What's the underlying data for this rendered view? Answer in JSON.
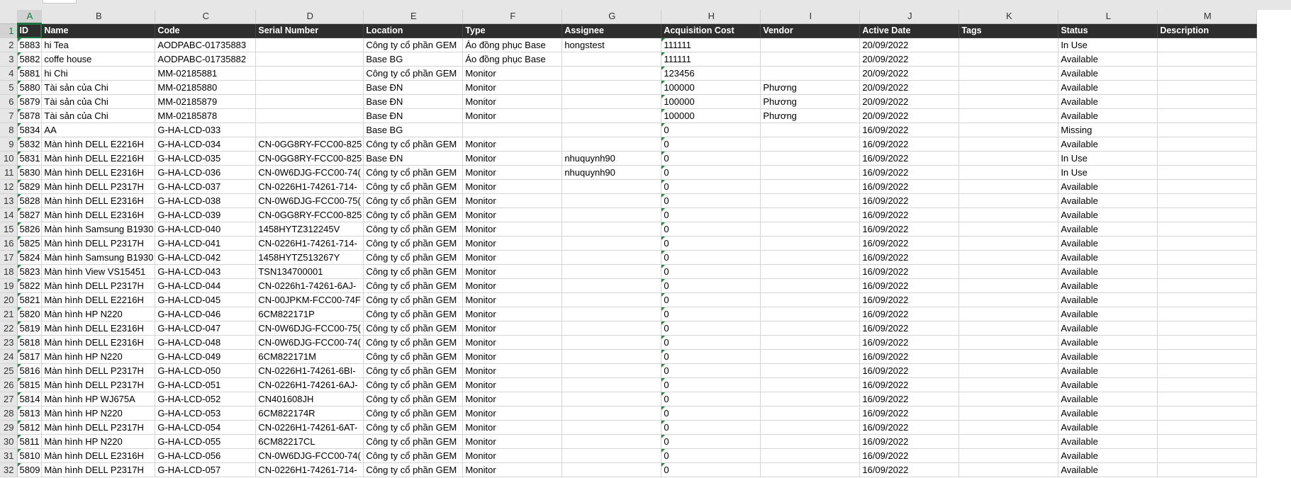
{
  "sheet": {
    "columns": [
      "A",
      "B",
      "C",
      "D",
      "E",
      "F",
      "G",
      "H",
      "I",
      "J",
      "K",
      "L",
      "M"
    ],
    "row_numbers": [
      "1",
      "2",
      "3",
      "4",
      "5",
      "6",
      "7",
      "8",
      "9",
      "10",
      "11",
      "12",
      "13",
      "14",
      "15",
      "16",
      "17",
      "18",
      "19",
      "20",
      "21",
      "22",
      "23",
      "24",
      "25",
      "26",
      "27",
      "28",
      "29",
      "30",
      "31",
      "32"
    ],
    "header": [
      "ID",
      "Name",
      "Code",
      "Serial Number",
      "Location",
      "Type",
      "Assignee",
      "Acquisition Cost",
      "Vendor",
      "Active Date",
      "Tags",
      "Status",
      "Description"
    ],
    "rows": [
      [
        "5883",
        "hi Tea",
        "AODPABC-01735883",
        "",
        "Công ty cổ phần GEM",
        "Áo đồng phục Base",
        "hongstest",
        "111111",
        "",
        "20/09/2022",
        "",
        "In Use",
        ""
      ],
      [
        "5882",
        "coffe house",
        "AODPABC-01735882",
        "",
        "Base BG",
        "Áo đồng phục Base",
        "",
        "111111",
        "",
        "20/09/2022",
        "",
        "Available",
        ""
      ],
      [
        "5881",
        "hi Chi",
        "MM-02185881",
        "",
        "Công ty cổ phần GEM",
        "Monitor",
        "",
        "123456",
        "",
        "20/09/2022",
        "",
        "Available",
        ""
      ],
      [
        "5880",
        "Tài sản của Chi",
        "MM-02185880",
        "",
        "Base ĐN",
        "Monitor",
        "",
        "100000",
        "Phương",
        "20/09/2022",
        "",
        "Available",
        ""
      ],
      [
        "5879",
        "Tài sản của Chi",
        "MM-02185879",
        "",
        "Base ĐN",
        "Monitor",
        "",
        "100000",
        "Phương",
        "20/09/2022",
        "",
        "Available",
        ""
      ],
      [
        "5878",
        "Tài sản của Chi",
        "MM-02185878",
        "",
        "Base ĐN",
        "Monitor",
        "",
        "100000",
        "Phương",
        "20/09/2022",
        "",
        "Available",
        ""
      ],
      [
        "5834",
        "AA",
        "G-HA-LCD-033",
        "",
        "Base BG",
        "",
        "",
        "0",
        "",
        "16/09/2022",
        "",
        "Missing",
        ""
      ],
      [
        "5832",
        "Màn hình DELL E2216H",
        "G-HA-LCD-034",
        "CN-0GG8RY-FCC00-825",
        "Công ty cổ phần GEM",
        "Monitor",
        "",
        "0",
        "",
        "16/09/2022",
        "",
        "Available",
        ""
      ],
      [
        "5831",
        "Màn hình DELL E2216H",
        "G-HA-LCD-035",
        "CN-0GG8RY-FCC00-825",
        "Base ĐN",
        "Monitor",
        "nhuquynh90",
        "0",
        "",
        "16/09/2022",
        "",
        "In Use",
        ""
      ],
      [
        "5830",
        "Màn hình DELL E2316H",
        "G-HA-LCD-036",
        "CN-0W6DJG-FCC00-74(",
        "Công ty cổ phần GEM",
        "Monitor",
        "nhuquynh90",
        "0",
        "",
        "16/09/2022",
        "",
        "In Use",
        ""
      ],
      [
        "5829",
        "Màn hình DELL P2317H",
        "G-HA-LCD-037",
        "CN-0226H1-74261-714-",
        "Công ty cổ phần GEM",
        "Monitor",
        "",
        "0",
        "",
        "16/09/2022",
        "",
        "Available",
        ""
      ],
      [
        "5828",
        "Màn hình DELL E2316H",
        "G-HA-LCD-038",
        "CN-0W6DJG-FCC00-75(",
        "Công ty cổ phần GEM",
        "Monitor",
        "",
        "0",
        "",
        "16/09/2022",
        "",
        "Available",
        ""
      ],
      [
        "5827",
        "Màn hình DELL E2316H",
        "G-HA-LCD-039",
        "CN-0GG8RY-FCC00-825",
        "Công ty cổ phần GEM",
        "Monitor",
        "",
        "0",
        "",
        "16/09/2022",
        "",
        "Available",
        ""
      ],
      [
        "5826",
        "Màn hình Samsung B1930",
        "G-HA-LCD-040",
        "1458HYTZ312245V",
        "Công ty cổ phần GEM",
        "Monitor",
        "",
        "0",
        "",
        "16/09/2022",
        "",
        "Available",
        ""
      ],
      [
        "5825",
        "Màn hình DELL P2317H",
        "G-HA-LCD-041",
        "CN-0226H1-74261-714-",
        "Công ty cổ phần GEM",
        "Monitor",
        "",
        "0",
        "",
        "16/09/2022",
        "",
        "Available",
        ""
      ],
      [
        "5824",
        "Màn hình Samsung B1930",
        "G-HA-LCD-042",
        "1458HYTZ513267Y",
        "Công ty cổ phần GEM",
        "Monitor",
        "",
        "0",
        "",
        "16/09/2022",
        "",
        "Available",
        ""
      ],
      [
        "5823",
        "Màn hình View VS15451",
        "G-HA-LCD-043",
        "TSN134700001",
        "Công ty cổ phần GEM",
        "Monitor",
        "",
        "0",
        "",
        "16/09/2022",
        "",
        "Available",
        ""
      ],
      [
        "5822",
        "Màn hình DELL P2317H",
        "G-HA-LCD-044",
        "CN-0226h1-74261-6AJ-",
        "Công ty cổ phần GEM",
        "Monitor",
        "",
        "0",
        "",
        "16/09/2022",
        "",
        "Available",
        ""
      ],
      [
        "5821",
        "Màn hình DELL E2216H",
        "G-HA-LCD-045",
        "CN-00JPKM-FCC00-74F",
        "Công ty cổ phần GEM",
        "Monitor",
        "",
        "0",
        "",
        "16/09/2022",
        "",
        "Available",
        ""
      ],
      [
        "5820",
        "Màn hình HP N220",
        "G-HA-LCD-046",
        "6CM822171P",
        "Công ty cổ phần GEM",
        "Monitor",
        "",
        "0",
        "",
        "16/09/2022",
        "",
        "Available",
        ""
      ],
      [
        "5819",
        "Màn hình DELL E2316H",
        "G-HA-LCD-047",
        "CN-0W6DJG-FCC00-75(",
        "Công ty cổ phần GEM",
        "Monitor",
        "",
        "0",
        "",
        "16/09/2022",
        "",
        "Available",
        ""
      ],
      [
        "5818",
        "Màn hình DELL E2316H",
        "G-HA-LCD-048",
        "CN-0W6DJG-FCC00-74(",
        "Công ty cổ phần GEM",
        "Monitor",
        "",
        "0",
        "",
        "16/09/2022",
        "",
        "Available",
        ""
      ],
      [
        "5817",
        "Màn hình HP N220",
        "G-HA-LCD-049",
        "6CM822171M",
        "Công ty cổ phần GEM",
        "Monitor",
        "",
        "0",
        "",
        "16/09/2022",
        "",
        "Available",
        ""
      ],
      [
        "5816",
        "Màn hình DELL P2317H",
        "G-HA-LCD-050",
        "CN-0226H1-74261-6BI-",
        "Công ty cổ phần GEM",
        "Monitor",
        "",
        "0",
        "",
        "16/09/2022",
        "",
        "Available",
        ""
      ],
      [
        "5815",
        "Màn hình DELL P2317H",
        "G-HA-LCD-051",
        "CN-0226H1-74261-6AJ-",
        "Công ty cổ phần GEM",
        "Monitor",
        "",
        "0",
        "",
        "16/09/2022",
        "",
        "Available",
        ""
      ],
      [
        "5814",
        "Màn hình HP WJ675A",
        "G-HA-LCD-052",
        "CN401608JH",
        "Công ty cổ phần GEM",
        "Monitor",
        "",
        "0",
        "",
        "16/09/2022",
        "",
        "Available",
        ""
      ],
      [
        "5813",
        "Màn hình HP N220",
        "G-HA-LCD-053",
        "6CM822174R",
        "Công ty cổ phần GEM",
        "Monitor",
        "",
        "0",
        "",
        "16/09/2022",
        "",
        "Available",
        ""
      ],
      [
        "5812",
        "Màn hình DELL P2317H",
        "G-HA-LCD-054",
        "CN-0226H1-74261-6AT-",
        "Công ty cổ phần GEM",
        "Monitor",
        "",
        "0",
        "",
        "16/09/2022",
        "",
        "Available",
        ""
      ],
      [
        "5811",
        "Màn hình HP N220",
        "G-HA-LCD-055",
        "6CM82217CL",
        "Công ty cổ phần GEM",
        "Monitor",
        "",
        "0",
        "",
        "16/09/2022",
        "",
        "Available",
        ""
      ],
      [
        "5810",
        "Màn hình DELL E2316H",
        "G-HA-LCD-056",
        "CN-0W6DJG-FCC00-74(",
        "Công ty cổ phần GEM",
        "Monitor",
        "",
        "0",
        "",
        "16/09/2022",
        "",
        "Available",
        ""
      ],
      [
        "5809",
        "Màn hình DELL P2317H",
        "G-HA-LCD-057",
        "CN-0226H1-74261-714-",
        "Công ty cổ phần GEM",
        "Monitor",
        "",
        "0",
        "",
        "16/09/2022",
        "",
        "Available",
        ""
      ]
    ],
    "selected_column": "A",
    "selected_row": "1",
    "accent_color": "#217346",
    "header_fill": "#2e2e2e"
  }
}
